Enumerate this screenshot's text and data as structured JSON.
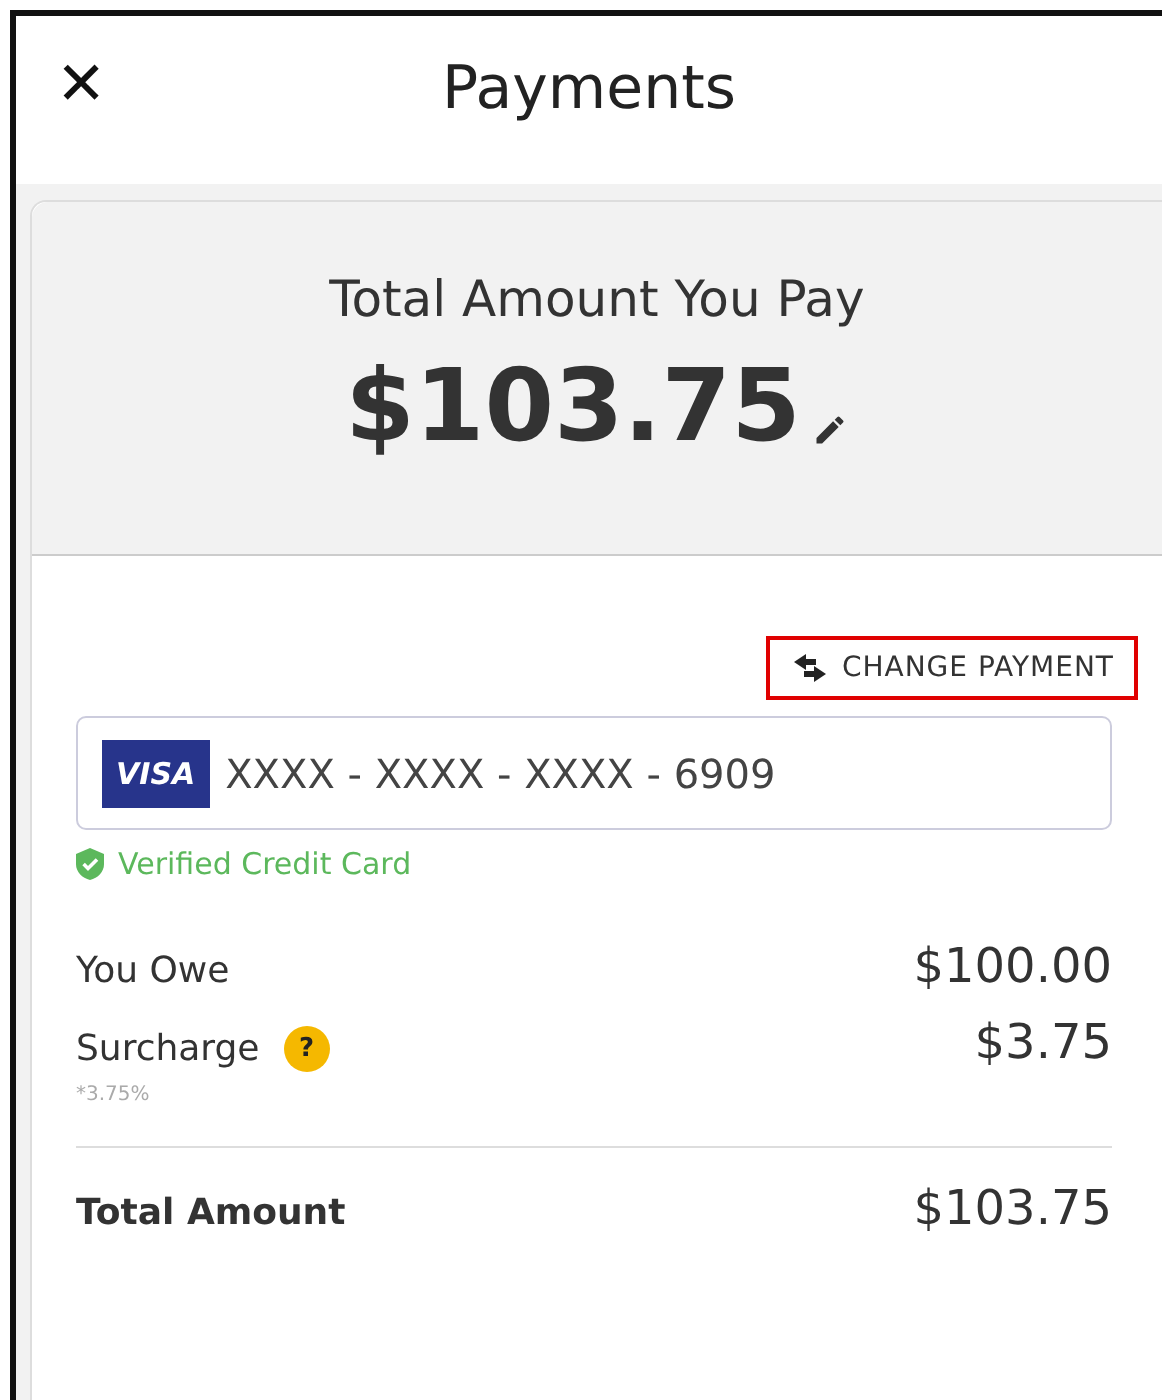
{
  "header": {
    "close_icon": "✕",
    "title": "Payments"
  },
  "summary": {
    "label": "Total Amount You Pay",
    "amount": "$103.75"
  },
  "change_payment": {
    "label": "CHANGE PAYMENT",
    "highlighted": true
  },
  "card": {
    "brand": "VISA",
    "number": "XXXX - XXXX - XXXX - 6909"
  },
  "verified": {
    "label": "Verified Credit Card"
  },
  "lines": [
    {
      "label": "You Owe",
      "value": "$100.00"
    },
    {
      "label": "Surcharge",
      "help": "?",
      "note": "*3.75%",
      "value": "$3.75"
    }
  ],
  "total": {
    "label": "Total Amount",
    "value": "$103.75"
  }
}
